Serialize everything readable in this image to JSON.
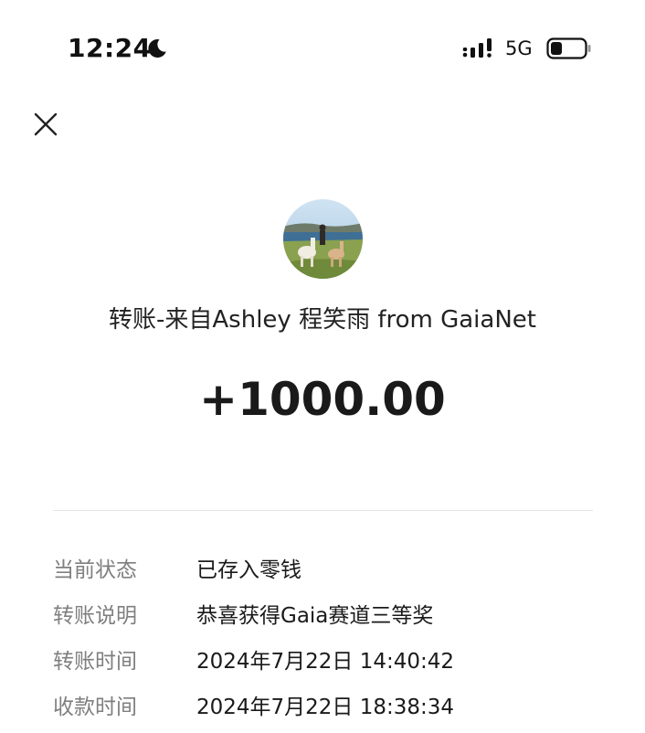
{
  "status_bar": {
    "time": "12:24",
    "moon_icon": "moon-icon",
    "signal_icon": "signal-icon",
    "network": "5G",
    "battery_icon": "battery-icon",
    "battery_level": 0.35
  },
  "close_icon": "close-icon",
  "transfer": {
    "avatar": "avatar",
    "title": "转账-来自Ashley 程笑雨 from GaiaNet",
    "amount": "+1000.00"
  },
  "details": [
    {
      "label": "当前状态",
      "value": "已存入零钱"
    },
    {
      "label": "转账说明",
      "value": "恭喜获得Gaia赛道三等奖"
    },
    {
      "label": "转账时间",
      "value": "2024年7月22日 14:40:42"
    },
    {
      "label": "收款时间",
      "value": "2024年7月22日 18:38:34"
    }
  ]
}
